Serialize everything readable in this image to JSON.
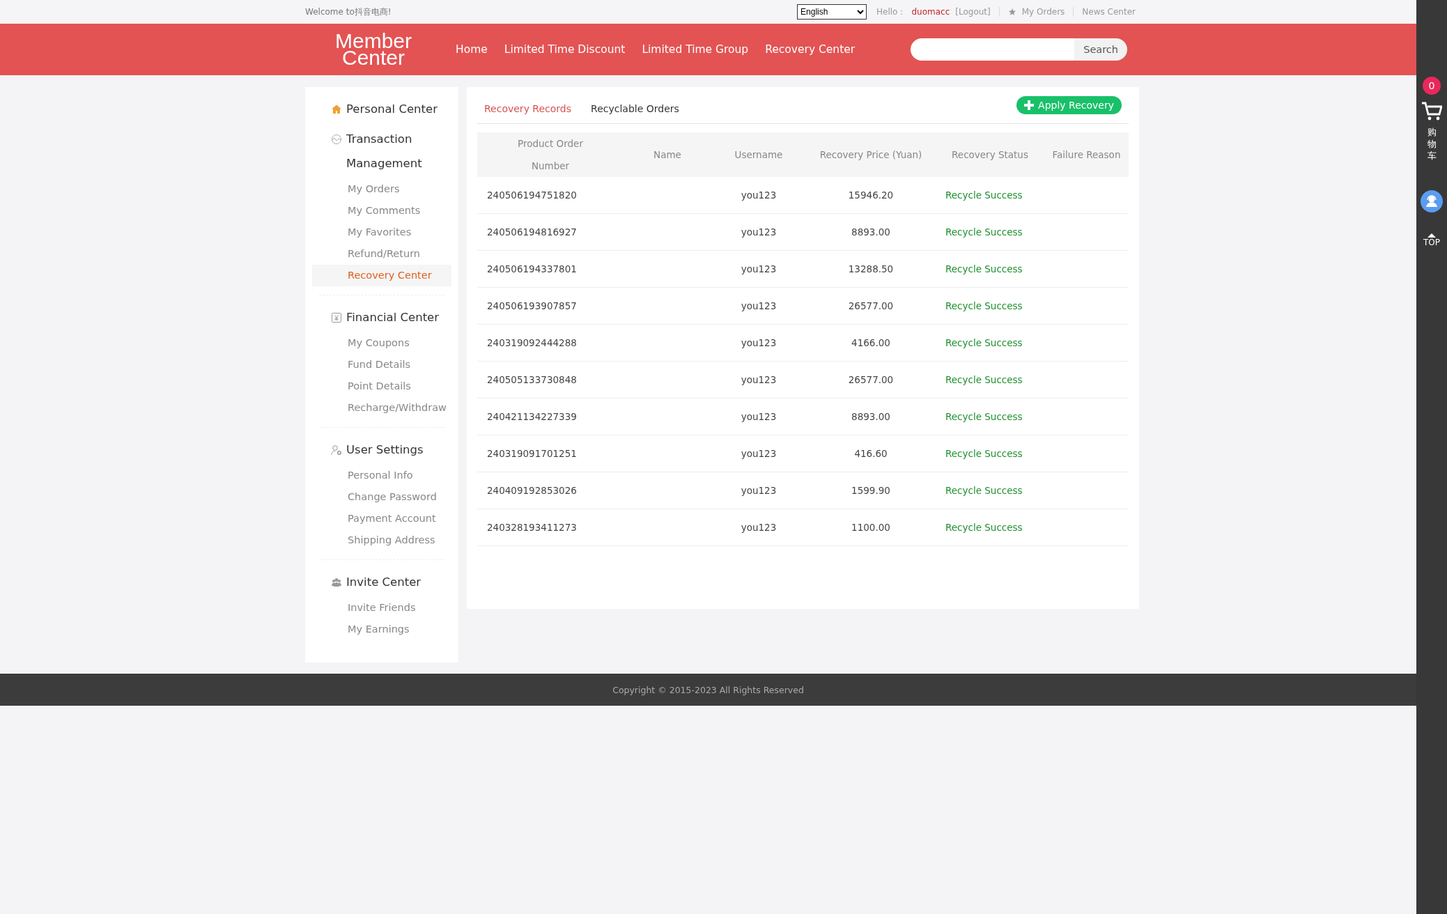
{
  "top_bar": {
    "welcome": "Welcome to抖音电商!",
    "language": "English",
    "greeting": "Hello：",
    "username": "duomacc",
    "logout": "[Logout]",
    "my_orders": "My Orders",
    "news_center": "News Center"
  },
  "header": {
    "logo": "Member Center",
    "nav": [
      "Home",
      "Limited Time Discount",
      "Limited Time Group",
      "Recovery Center"
    ],
    "search": {
      "button": "Search"
    }
  },
  "sidebar": {
    "personal_center": "Personal Center",
    "sections": [
      {
        "title": "Transaction Management",
        "items": [
          {
            "label": "My Orders",
            "selected": false
          },
          {
            "label": "My Comments",
            "selected": false
          },
          {
            "label": "My Favorites",
            "selected": false
          },
          {
            "label": "Refund/Return",
            "selected": false
          },
          {
            "label": "Recovery Center",
            "selected": true
          }
        ]
      },
      {
        "title": "Financial Center",
        "items": [
          {
            "label": "My Coupons",
            "selected": false
          },
          {
            "label": "Fund Details",
            "selected": false
          },
          {
            "label": "Point Details",
            "selected": false
          },
          {
            "label": "Recharge/Withdraw",
            "selected": false
          }
        ]
      },
      {
        "title": "User Settings",
        "items": [
          {
            "label": "Personal Info",
            "selected": false
          },
          {
            "label": "Change Password",
            "selected": false
          },
          {
            "label": "Payment Account",
            "selected": false
          },
          {
            "label": "Shipping Address",
            "selected": false
          }
        ]
      },
      {
        "title": "Invite Center",
        "items": [
          {
            "label": "Invite Friends",
            "selected": false
          },
          {
            "label": "My Earnings",
            "selected": false
          }
        ]
      }
    ]
  },
  "tabs": [
    {
      "label": "Recovery Records",
      "selected": true
    },
    {
      "label": "Recyclable Orders",
      "selected": false
    }
  ],
  "apply_button": "Apply Recovery",
  "table": {
    "columns": [
      "Product Order Number",
      "Name",
      "Username",
      "Recovery Price (Yuan)",
      "Recovery Status",
      "Failure Reason"
    ],
    "rows": [
      {
        "order": "240506194751820",
        "username": "you123",
        "price": "15946.20",
        "status": "Recycle Success"
      },
      {
        "order": "240506194816927",
        "username": "you123",
        "price": "8893.00",
        "status": "Recycle Success"
      },
      {
        "order": "240506194337801",
        "username": "you123",
        "price": "13288.50",
        "status": "Recycle Success"
      },
      {
        "order": "240506193907857",
        "username": "you123",
        "price": "26577.00",
        "status": "Recycle Success"
      },
      {
        "order": "240319092444288",
        "username": "you123",
        "price": "4166.00",
        "status": "Recycle Success"
      },
      {
        "order": "240505133730848",
        "username": "you123",
        "price": "26577.00",
        "status": "Recycle Success"
      },
      {
        "order": "240421134227339",
        "username": "you123",
        "price": "8893.00",
        "status": "Recycle Success"
      },
      {
        "order": "240319091701251",
        "username": "you123",
        "price": "416.60",
        "status": "Recycle Success"
      },
      {
        "order": "240409192853026",
        "username": "you123",
        "price": "1599.90",
        "status": "Recycle Success"
      },
      {
        "order": "240328193411273",
        "username": "you123",
        "price": "1100.00",
        "status": "Recycle Success"
      }
    ]
  },
  "footer": {
    "copyright": "Copyright © 2015-2023 All Rights Reserved"
  },
  "side_rail": {
    "cart_count": "0",
    "cart_label": "购物车",
    "top_label": "TOP"
  }
}
